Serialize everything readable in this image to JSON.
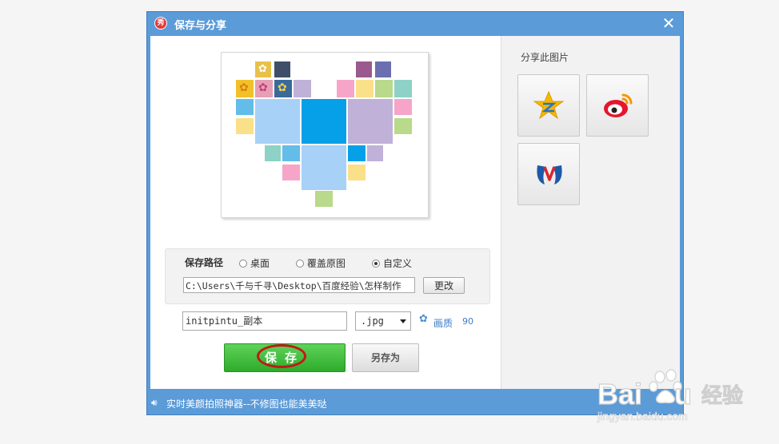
{
  "window": {
    "title": "保存与分享",
    "app_icon": "秀",
    "close_label": "✕"
  },
  "preview": {
    "tiles_colors": [
      "#a7d1f7",
      "#06a0e8",
      "#c0b1d8",
      "#f6a5c8",
      "#fbe08a",
      "#b9d98b",
      "#8ed1c6",
      "#63bde8"
    ]
  },
  "save_path": {
    "label": "保存路径",
    "options": [
      {
        "label": "桌面",
        "selected": false
      },
      {
        "label": "覆盖原图",
        "selected": false
      },
      {
        "label": "自定义",
        "selected": true
      }
    ],
    "path_value": "C:\\Users\\千与千寻\\Desktop\\百度经验\\怎样制作",
    "change_button": "更改"
  },
  "file": {
    "name_value": "initpintu_副本",
    "extension": ".jpg",
    "quality_label": "画质",
    "quality_value": "90"
  },
  "actions": {
    "save_label": "保存",
    "save_as_label": "另存为"
  },
  "share": {
    "title": "分享此图片",
    "targets": [
      "qzone-icon",
      "weibo-icon",
      "renren-icon"
    ]
  },
  "status": {
    "text": "实时美颜拍照神器--不修图也能美美哒"
  },
  "watermark": {
    "brand": "Baidu经验",
    "url": "jingyan.baidu.com"
  }
}
